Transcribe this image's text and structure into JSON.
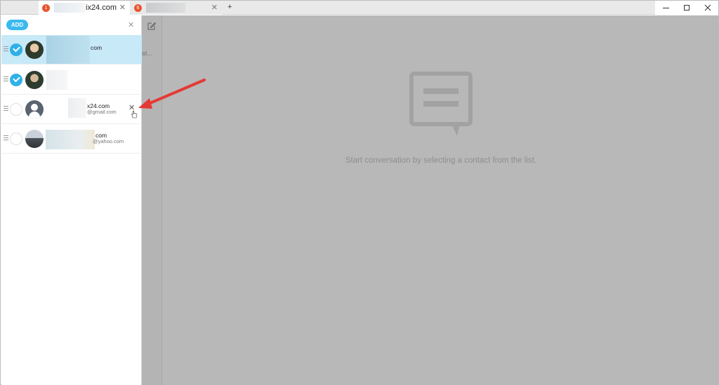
{
  "tabs": [
    {
      "badge": "1",
      "title": "ix24.com",
      "close": "✕"
    },
    {
      "badge": "6",
      "title": "",
      "close": "✕"
    }
  ],
  "new_tab": "+",
  "panel": {
    "add_label": "ADD",
    "close": "✕"
  },
  "contacts": [
    {
      "name": "com",
      "email": "",
      "selected": true,
      "checked": true
    },
    {
      "name": "",
      "email": "",
      "selected": false,
      "checked": true
    },
    {
      "name": "x24.com",
      "email": "@gmail.com",
      "selected": false,
      "checked": false,
      "remove": "✕"
    },
    {
      "name": "com",
      "email": "@yahoo.com",
      "selected": false,
      "checked": false
    }
  ],
  "main": {
    "peek_text": "at...",
    "empty_message": "Start conversation by selecting a contact from the list."
  },
  "colors": {
    "accent": "#2fb1e8",
    "badge": "#e8542f",
    "arrow": "#e53935",
    "overlay": "#b8b8b8"
  },
  "icons": [
    "compose-icon",
    "chat-bubble-icon",
    "checkmark-icon",
    "drag-handle-icon",
    "user-placeholder-icon",
    "hand-cursor-icon",
    "red-arrow"
  ]
}
